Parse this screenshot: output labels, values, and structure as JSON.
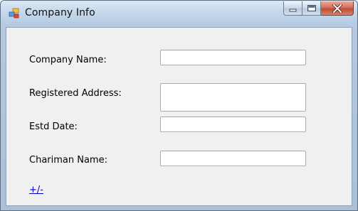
{
  "window": {
    "title": "Company Info",
    "icon": "application-form-icon",
    "buttons": [
      "minimize-icon",
      "maximize-icon",
      "close-icon"
    ]
  },
  "form": {
    "company_name_label": "Company Name:",
    "company_name_value": "",
    "registered_address_label": "Registered Address:",
    "registered_address_value": "",
    "estd_date_label": "Estd Date:",
    "estd_date_value": "",
    "chairman_name_label": "Chariman Name:",
    "chairman_name_value": "",
    "toggle_link": "+/-"
  },
  "colors": {
    "close_button": "#c34a32",
    "link": "#0000cc"
  }
}
